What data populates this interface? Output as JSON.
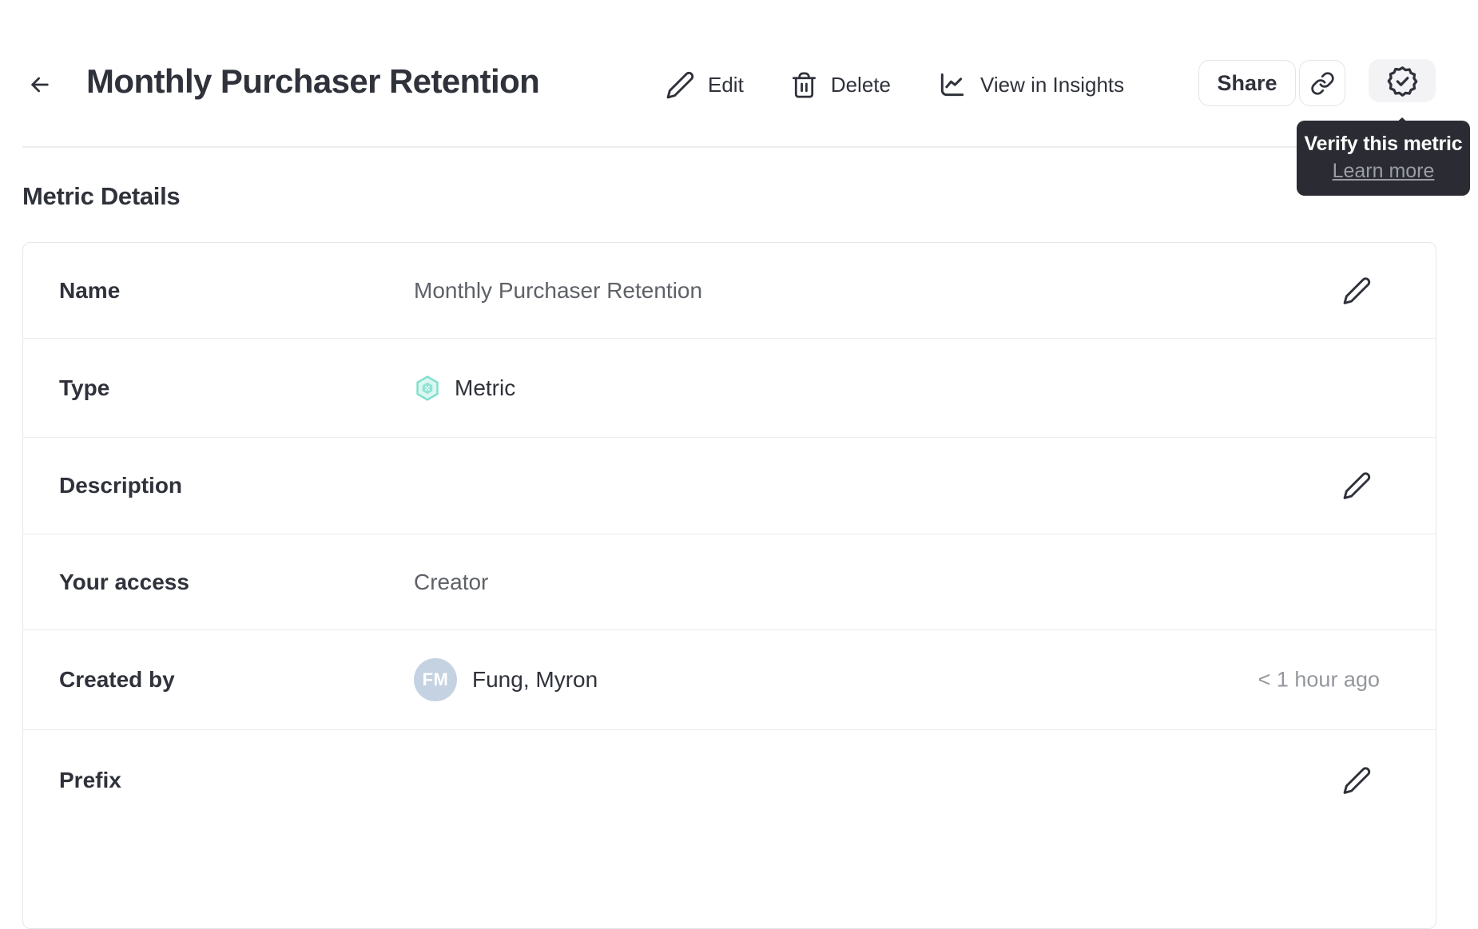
{
  "header": {
    "title": "Monthly Purchaser Retention",
    "actions": {
      "edit": "Edit",
      "delete": "Delete",
      "view_in_insights": "View in Insights",
      "share": "Share"
    }
  },
  "tooltip": {
    "title": "Verify this metric",
    "link": "Learn more"
  },
  "section": {
    "heading": "Metric Details"
  },
  "details": {
    "name": {
      "label": "Name",
      "value": "Monthly Purchaser Retention"
    },
    "type": {
      "label": "Type",
      "value": "Metric"
    },
    "description": {
      "label": "Description",
      "value": ""
    },
    "access": {
      "label": "Your access",
      "value": "Creator"
    },
    "created_by": {
      "label": "Created by",
      "value": "Fung, Myron",
      "avatar_initials": "FM",
      "timestamp": "< 1 hour ago"
    },
    "prefix": {
      "label": "Prefix",
      "value": ""
    }
  },
  "icons": {
    "back": "arrow-left-icon",
    "edit": "pencil-icon",
    "delete": "trash-icon",
    "view_in_insights": "line-chart-icon",
    "copy_link": "link-icon",
    "verify": "verified-badge-icon",
    "metric_type": "hexagon-metric-icon",
    "row_edit": "pencil-icon"
  },
  "colors": {
    "accent_teal": "#7de0cd",
    "accent_teal_light": "#dcf7f1",
    "accent_teal_mid": "#8fe5d5",
    "avatar_bg": "#c5d2e2",
    "tooltip_bg": "#2b2c33",
    "text_dark": "#2f323a",
    "text_gray": "#5e6167"
  }
}
